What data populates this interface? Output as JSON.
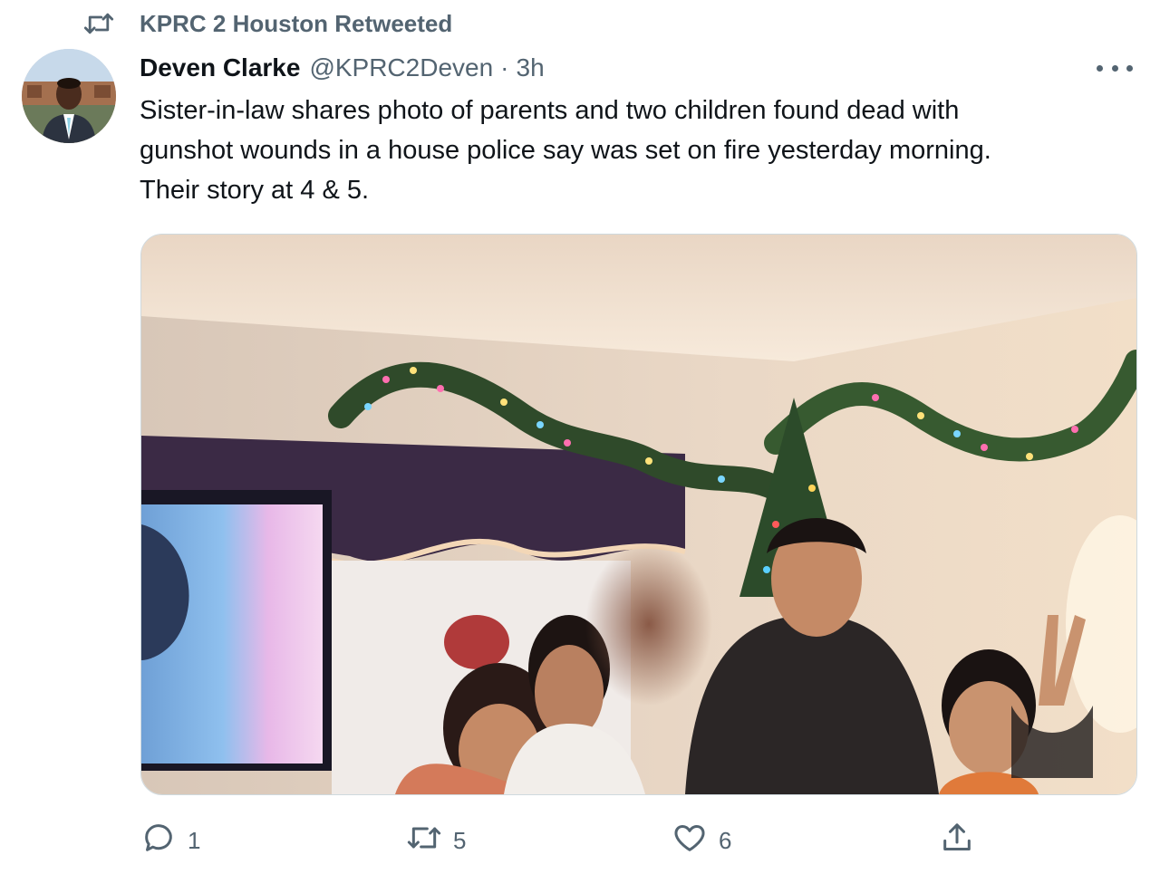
{
  "retweet_banner": {
    "icon": "retweet-icon",
    "text": "KPRC 2 Houston Retweeted"
  },
  "author": {
    "display_name": "Deven Clarke",
    "handle": "@KPRC2Deven",
    "separator": "·",
    "time": "3h",
    "avatar_icon": "avatar"
  },
  "tweet": {
    "text": "Sister-in-law shares photo of parents and two children found dead with\ngunshot wounds in a house police say was set on fire yesterday morning.\nTheir story at 4 & 5."
  },
  "actions": {
    "reply": {
      "icon": "reply-icon",
      "count": "1"
    },
    "retweet": {
      "icon": "retweet-icon",
      "count": "5"
    },
    "like": {
      "icon": "heart-icon",
      "count": "6"
    },
    "share": {
      "icon": "share-icon"
    }
  },
  "colors": {
    "text_primary": "#0f1419",
    "text_secondary": "#536471",
    "border": "#cfd9de"
  }
}
